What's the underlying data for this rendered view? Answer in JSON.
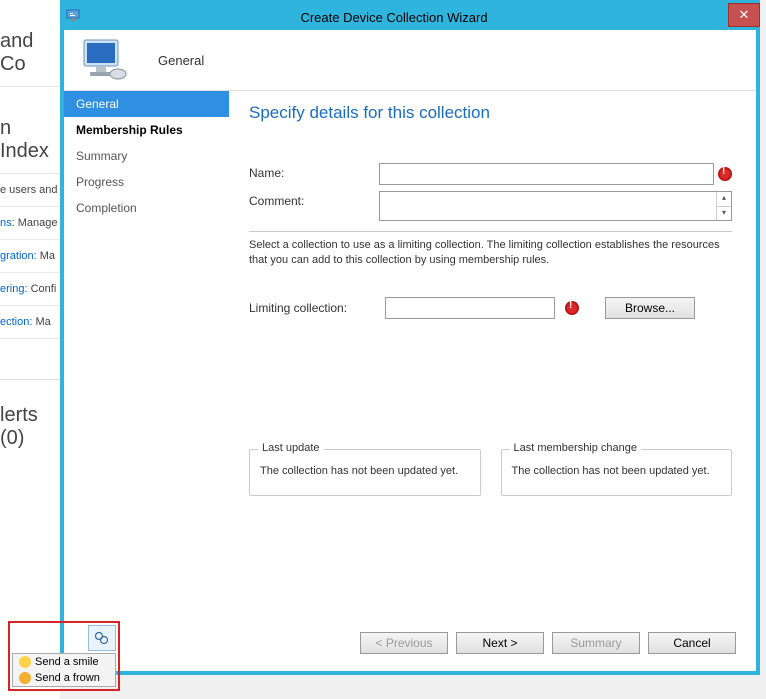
{
  "bg": {
    "heading1": "and Co",
    "heading2": "n Index",
    "row0": "e users and",
    "row1_a": "ns:",
    "row1_b": "Manage",
    "row2_a": "gration:",
    "row2_b": "Ma",
    "row3_a": "ering:",
    "row3_b": "Confi",
    "row4_a": "ection:",
    "row4_b": "Ma",
    "alerts": "lerts (0)"
  },
  "wizard": {
    "title": "Create Device Collection Wizard",
    "bannerStep": "General",
    "nav": {
      "general": "General",
      "membership": "Membership Rules",
      "summary": "Summary",
      "progress": "Progress",
      "completion": "Completion"
    },
    "content": {
      "heading": "Specify details for this collection",
      "nameLabel": "Name:",
      "nameValue": "",
      "commentLabel": "Comment:",
      "help": "Select a collection to use as a limiting collection. The limiting collection establishes the resources that you can add to this collection by using membership rules.",
      "limitLabel": "Limiting collection:",
      "limitValue": "",
      "browse": "Browse...",
      "group1Title": "Last update",
      "group1Msg": "The collection has not been updated yet.",
      "group2Title": "Last membership change",
      "group2Msg": "The collection has not been updated yet."
    },
    "footer": {
      "prev": "< Previous",
      "next": "Next >",
      "summary": "Summary",
      "cancel": "Cancel"
    }
  },
  "feedback": {
    "smile": "Send a smile",
    "frown": "Send a frown"
  }
}
